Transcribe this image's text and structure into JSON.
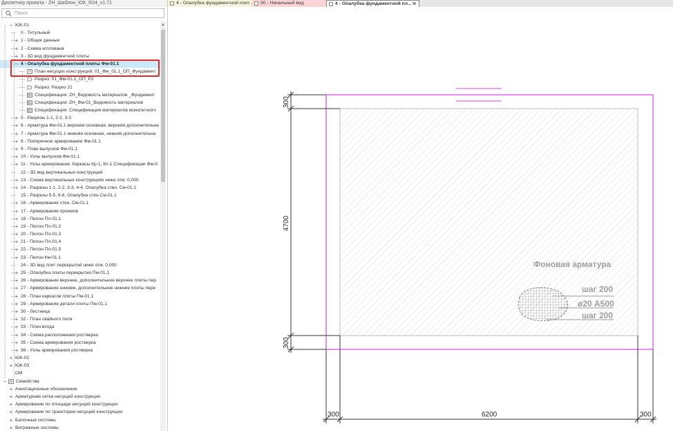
{
  "panel": {
    "title": "Диспетчер проекта - ZH_Шаблон_ЮК_R24_v1.71",
    "search_placeholder": "Поиск"
  },
  "tree": [
    {
      "level": 0,
      "toggle": "−",
      "text": "ЮК-01",
      "icon": "none"
    },
    {
      "level": 1,
      "toggle": "",
      "text": "0 - Титульный",
      "icon": "none"
    },
    {
      "level": 1,
      "toggle": "+",
      "text": "1 - Общие данные",
      "icon": "none"
    },
    {
      "level": 1,
      "toggle": "+",
      "text": "2 - Схема котлована",
      "icon": "none"
    },
    {
      "level": 1,
      "toggle": "+",
      "text": "3 - 3D вид фундаментной плиты",
      "icon": "none"
    },
    {
      "level": 1,
      "toggle": "−",
      "text": "4 - Опалубка фундаментной плиты Фм-01.1",
      "icon": "none",
      "selected": true
    },
    {
      "level": 2,
      "toggle": "",
      "text": "План несущих конструкций: 01_Фм_01.1_ОП_Фундамент",
      "icon": "plan"
    },
    {
      "level": 2,
      "toggle": "",
      "text": "Разрез: 01_Фм-01.1_ОП_Р2",
      "icon": "section"
    },
    {
      "level": 2,
      "toggle": "",
      "text": "Разрез: Разрез 21",
      "icon": "section"
    },
    {
      "level": 2,
      "toggle": "",
      "text": "Спецификация: ZH_Ведомость материалов _Фундамент",
      "icon": "table"
    },
    {
      "level": 2,
      "toggle": "",
      "text": "Спецификация: ZH_Фм-01_Ведомость материалов",
      "icon": "table"
    },
    {
      "level": 2,
      "toggle": "",
      "text": "Спецификация: Спецификация материалов монолитного",
      "icon": "table"
    },
    {
      "level": 1,
      "toggle": "+",
      "text": "5 - Разрезы 1-1, 2-2, 3-3",
      "icon": "none"
    },
    {
      "level": 1,
      "toggle": "+",
      "text": "6 - Арматура Фм-01.1 верхняя основная, верхняя дополнительна",
      "icon": "none"
    },
    {
      "level": 1,
      "toggle": "+",
      "text": "7 - Арматура Фм-01.1 нижняя основная, нижняя дополнительна",
      "icon": "none"
    },
    {
      "level": 1,
      "toggle": "+",
      "text": "8 - Поперечное армирование Фм-01.1",
      "icon": "none"
    },
    {
      "level": 1,
      "toggle": "+",
      "text": "9 - План выпусков Фм-01.1",
      "icon": "none"
    },
    {
      "level": 1,
      "toggle": "+",
      "text": "10 - Узлы выпусков Фм-01.1",
      "icon": "none"
    },
    {
      "level": 1,
      "toggle": "+",
      "text": "11 - Узлы армирования. Каркасы Кр-1, Кп-1 Спецификации Фм-0",
      "icon": "none"
    },
    {
      "level": 1,
      "toggle": "",
      "text": "12 - 3D вид вертикальных конструкций",
      "icon": "none"
    },
    {
      "level": 1,
      "toggle": "+",
      "text": "13 - Схема вертикальных конструкциях ниже отм. 0,000",
      "icon": "none"
    },
    {
      "level": 1,
      "toggle": "+",
      "text": "14 - Разрезы 1-1, 2-2, 3-3, 4-4. Опалубка стен. См-01.1",
      "icon": "none"
    },
    {
      "level": 1,
      "toggle": "",
      "text": "15 - Разрезы 5-5, 6-6. Опалубка стен См-01.1",
      "icon": "none"
    },
    {
      "level": 1,
      "toggle": "+",
      "text": "16 - Армирование стен. См-01.1",
      "icon": "none"
    },
    {
      "level": 1,
      "toggle": "+",
      "text": "17 - Армирование проемов",
      "icon": "none"
    },
    {
      "level": 1,
      "toggle": "+",
      "text": "18 - Пилон Пл-01.1",
      "icon": "none"
    },
    {
      "level": 1,
      "toggle": "+",
      "text": "19 - Пилон Пл-01.2",
      "icon": "none"
    },
    {
      "level": 1,
      "toggle": "+",
      "text": "20 - Пилон Пл-01.3",
      "icon": "none"
    },
    {
      "level": 1,
      "toggle": "+",
      "text": "21 - Пилон Пл-01.4",
      "icon": "none"
    },
    {
      "level": 1,
      "toggle": "+",
      "text": "22 - Пилон Пл-01.5",
      "icon": "none"
    },
    {
      "level": 1,
      "toggle": "+",
      "text": "23 - Пилон Км-01.1",
      "icon": "none"
    },
    {
      "level": 1,
      "toggle": "",
      "text": "24 - 3D вид плит перекрытий ниже отм. 0,000",
      "icon": "none"
    },
    {
      "level": 1,
      "toggle": "+",
      "text": "25 - Опалубка плиты перекрытия Пм-01.1",
      "icon": "none"
    },
    {
      "level": 1,
      "toggle": "+",
      "text": "26 - Армирование верхнее, дополнительное верхнее плиты пер",
      "icon": "none"
    },
    {
      "level": 1,
      "toggle": "+",
      "text": "27 - Армирование нижнее, дополнительное нижнее плиты пере",
      "icon": "none"
    },
    {
      "level": 1,
      "toggle": "+",
      "text": "28 - План каркасов плиты Пм-01.1",
      "icon": "none"
    },
    {
      "level": 1,
      "toggle": "+",
      "text": "29 - Армирование детали плиты Пм-01.1",
      "icon": "none"
    },
    {
      "level": 1,
      "toggle": "+",
      "text": "30 - Лестница",
      "icon": "none"
    },
    {
      "level": 1,
      "toggle": "+",
      "text": "32 - План свайного поля",
      "icon": "none"
    },
    {
      "level": 1,
      "toggle": "+",
      "text": "33 - План входа",
      "icon": "none"
    },
    {
      "level": 1,
      "toggle": "+",
      "text": "34 - Схема расположения ростверка",
      "icon": "none"
    },
    {
      "level": 1,
      "toggle": "+",
      "text": "35 - Схема армирования ростверка",
      "icon": "none"
    },
    {
      "level": 1,
      "toggle": "+",
      "text": "36 - Узлы армирования ростверка",
      "icon": "none"
    },
    {
      "level": 0,
      "toggle": "+",
      "text": "ЮК-02",
      "icon": "none"
    },
    {
      "level": 0,
      "toggle": "+",
      "text": "ЮК-03",
      "icon": "none"
    },
    {
      "level": 0,
      "toggle": "",
      "text": "ОМ",
      "icon": "none"
    },
    {
      "level": -1,
      "toggle": "−",
      "text": "Семейства",
      "icon": "family"
    },
    {
      "level": 0,
      "toggle": "+",
      "text": "Аннотационные обозначения",
      "icon": "none"
    },
    {
      "level": 0,
      "toggle": "+",
      "text": "Арматурная сетка несущей конструкции",
      "icon": "none"
    },
    {
      "level": 0,
      "toggle": "+",
      "text": "Армирование по площади несущей конструкции",
      "icon": "none"
    },
    {
      "level": 0,
      "toggle": "+",
      "text": "Армирование по траектории несущей конструкции",
      "icon": "none"
    },
    {
      "level": 0,
      "toggle": "+",
      "text": "Балочные системы",
      "icon": "none"
    },
    {
      "level": 0,
      "toggle": "+",
      "text": "Витражные системы",
      "icon": "none"
    }
  ],
  "tabs": [
    {
      "label": "4 - Опалубка фундаментной плит...",
      "bg": "#f5f5dc",
      "active": false,
      "close": false
    },
    {
      "label": "00 - Начальный вид",
      "bg": "#f9d3d6",
      "active": false,
      "close": false
    },
    {
      "label": "4 - Опалубка фундаментной пл...",
      "bg": "#ffffff",
      "active": true,
      "close": true
    }
  ],
  "drawing": {
    "dimensions": {
      "left_top": "300",
      "left_middle": "4700",
      "left_bottom": "300",
      "bottom_left": "300",
      "bottom_middle": "6200",
      "bottom_right": "300"
    },
    "annotation": {
      "background_rebar": "Фоновая арматура",
      "step_top": "шаг 200",
      "bar_spec": "ø20 А500",
      "step_bottom": "шаг 200"
    },
    "colors": {
      "slab_outline": "#e040e8",
      "hatch": "#cfcfcf",
      "lines": "#333333",
      "annotation": "#9e9e9e"
    }
  }
}
